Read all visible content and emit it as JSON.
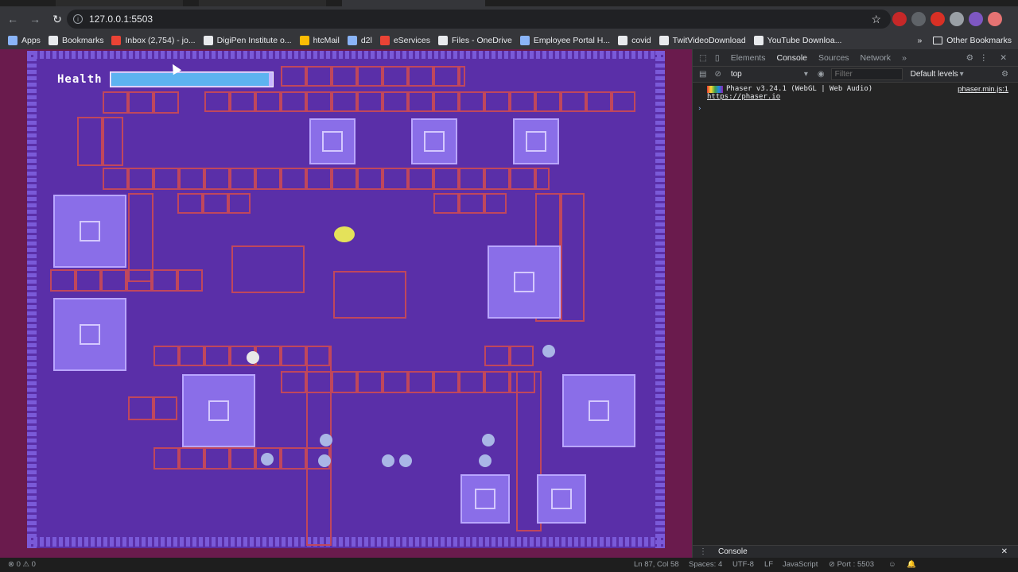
{
  "browser": {
    "url": "127.0.0.1:5503",
    "bookmarks": [
      {
        "label": "Apps",
        "color": "#8ab4f8"
      },
      {
        "label": "Bookmarks",
        "color": "#e8eaed"
      },
      {
        "label": "Inbox (2,754) - jo...",
        "color": "#ea4335"
      },
      {
        "label": "DigiPen Institute o...",
        "color": "#e8eaed"
      },
      {
        "label": "htcMail",
        "color": "#fbbc04"
      },
      {
        "label": "d2l",
        "color": "#8ab4f8"
      },
      {
        "label": "eServices",
        "color": "#ea4335"
      },
      {
        "label": "Files - OneDrive",
        "color": "#e8eaed"
      },
      {
        "label": "Employee Portal H...",
        "color": "#8ab4f8"
      },
      {
        "label": "covid",
        "color": "#e8eaed"
      },
      {
        "label": "TwitVideoDownload",
        "color": "#e8eaed"
      },
      {
        "label": "YouTube Downloa...",
        "color": "#e8eaed"
      }
    ],
    "more_bookmarks": "»",
    "other_bookmarks": "Other Bookmarks",
    "extensions": [
      {
        "name": "abp-icon",
        "color": "#c62828"
      },
      {
        "name": "extension-icon-1",
        "color": "#5f6368"
      },
      {
        "name": "pdf-icon",
        "color": "#d93025"
      },
      {
        "name": "puzzle-icon",
        "color": "#9aa0a6"
      },
      {
        "name": "profile-avatar",
        "color": "#7e57c2"
      },
      {
        "name": "update-icon",
        "color": "#e57373"
      }
    ]
  },
  "game": {
    "health_label": "Health",
    "health_fraction": 0.98,
    "colors": {
      "floor": "#5a2fa8",
      "wall": "#7a5ad8",
      "brick": "#c0475c",
      "accent": "#8a6ee8"
    }
  },
  "devtools": {
    "tabs": [
      "Elements",
      "Console",
      "Sources",
      "Network"
    ],
    "active_tab": "Console",
    "more": "»",
    "context": "top",
    "filter_placeholder": "Filter",
    "levels": "Default levels",
    "log": {
      "message": "Phaser v3.24.1 (WebGL | Web Audio)",
      "link": "https://phaser.io",
      "source": "phaser.min.js:1"
    },
    "prompt": "›",
    "drawer_tab": "Console"
  },
  "statusbar": {
    "problems": "⊗ 0 ⚠ 0",
    "cursor": "Ln 87, Col 58",
    "spaces": "Spaces: 4",
    "encoding": "UTF-8",
    "eol": "LF",
    "language": "JavaScript",
    "port": "⊘ Port : 5503"
  }
}
